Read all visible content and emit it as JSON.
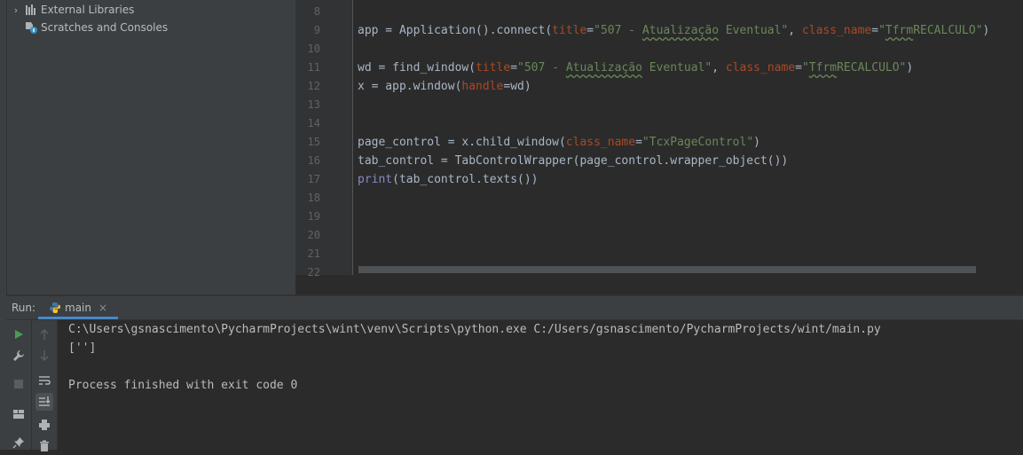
{
  "project_tree": {
    "items": [
      {
        "label": "External Libraries",
        "icon": "libraries-icon",
        "expandable": true
      },
      {
        "label": "Scratches and Consoles",
        "icon": "scratches-icon",
        "expandable": false
      }
    ]
  },
  "editor": {
    "line_numbers": [
      "8",
      "9",
      "10",
      "11",
      "12",
      "13",
      "14",
      "15",
      "16",
      "17",
      "18",
      "19",
      "20",
      "21",
      "22"
    ],
    "lines": {
      "l9": {
        "a": "app = Application().connect(",
        "k1": "title",
        "b": "=",
        "s1a": "\"507 - ",
        "s1typo": "Atualização",
        "s1b": " Eventual\"",
        "c": ", ",
        "k2": "class_name",
        "d": "=",
        "s2a": "\"",
        "s2typo": "Tfrm",
        "s2b": "RECALCULO\"",
        "e": ")"
      },
      "l11": {
        "a": "wd = find_window(",
        "k1": "title",
        "b": "=",
        "s1a": "\"507 - ",
        "s1typo": "Atualização",
        "s1b": " Eventual\"",
        "c": ", ",
        "k2": "class_name",
        "d": "=",
        "s2a": "\"",
        "s2typo": "Tfrm",
        "s2b": "RECALCULO\"",
        "e": ")"
      },
      "l12": {
        "a": "x = app.window(",
        "k1": "handle",
        "b": "=wd)"
      },
      "l15": {
        "a": "page_control = x.child_window(",
        "k1": "class_name",
        "b": "=",
        "s1": "\"TcxPageControl\"",
        "c": ")"
      },
      "l16": {
        "a": "tab_control = TabControlWrapper(page_control.wrapper_object())"
      },
      "l17": {
        "bi": "print",
        "a": "(tab_control.texts())"
      }
    }
  },
  "run_panel": {
    "label": "Run:",
    "tab_label": "main",
    "tab_close": "×",
    "console_lines": [
      "C:\\Users\\gsnascimento\\PycharmProjects\\wint\\venv\\Scripts\\python.exe C:/Users/gsnascimento/PycharmProjects/wint/main.py",
      "['']",
      "",
      "Process finished with exit code 0"
    ]
  },
  "colors": {
    "run_green": "#499c54",
    "keyword_orange": "#aa4926",
    "string_green": "#6a8759",
    "builtin_purple": "#8888c6",
    "tab_underline": "#4a88c7"
  }
}
